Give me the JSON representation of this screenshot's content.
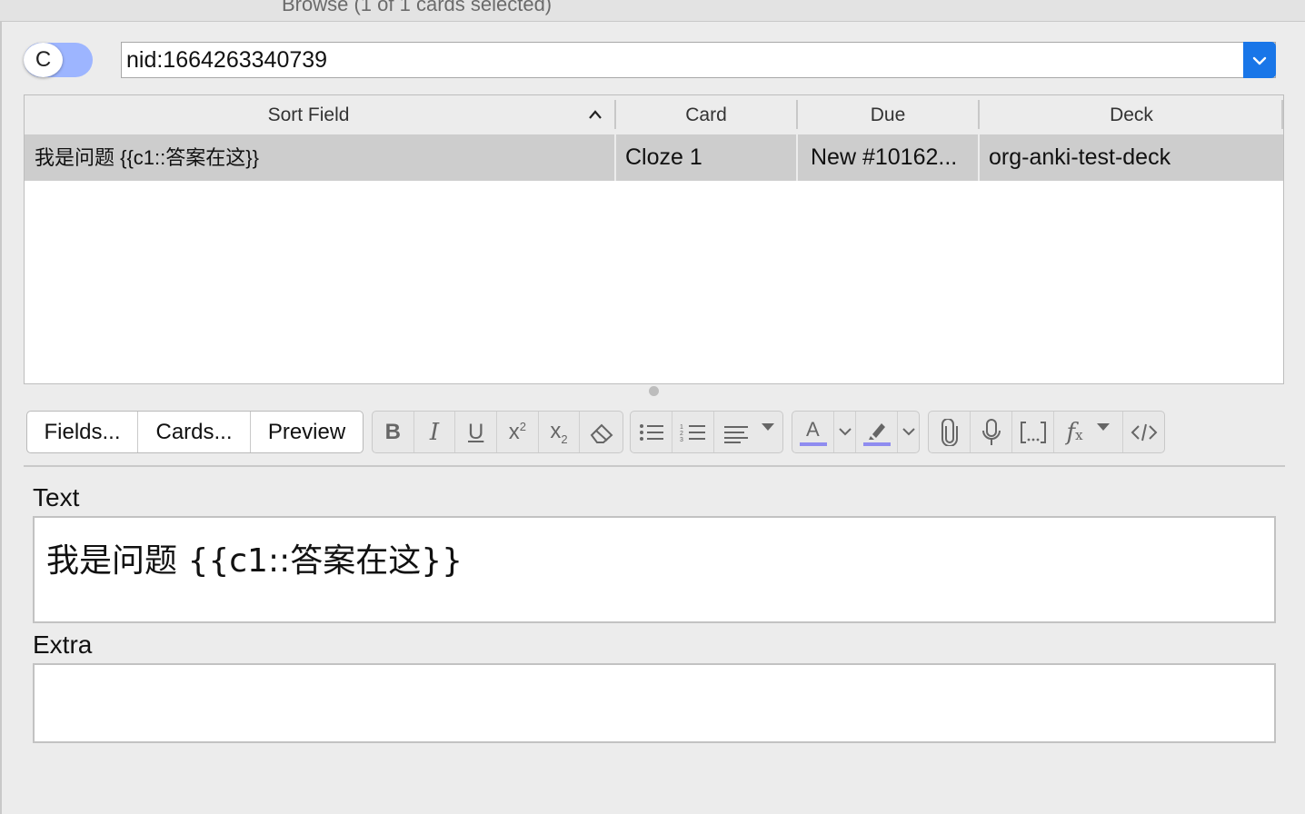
{
  "window": {
    "title": "Browse (1 of 1 cards selected)"
  },
  "search": {
    "mode_toggle_letter": "C",
    "query": "nid:1664263340739"
  },
  "table": {
    "columns": [
      "Sort Field",
      "Card",
      "Due",
      "Deck"
    ],
    "rows": [
      {
        "sort_field": "我是问题 {{c1::答案在这}}",
        "card": "Cloze 1",
        "due": "New #10162...",
        "deck": "org-anki-test-deck"
      }
    ]
  },
  "toolbar": {
    "fields_label": "Fields...",
    "cards_label": "Cards...",
    "preview_label": "Preview",
    "text_color": "#8f8cf0",
    "highlight_color": "#8f8cf0"
  },
  "editor": {
    "fields": [
      {
        "label": "Text",
        "value": "我是问题 {{c1::答案在这}}"
      },
      {
        "label": "Extra",
        "value": ""
      }
    ]
  }
}
